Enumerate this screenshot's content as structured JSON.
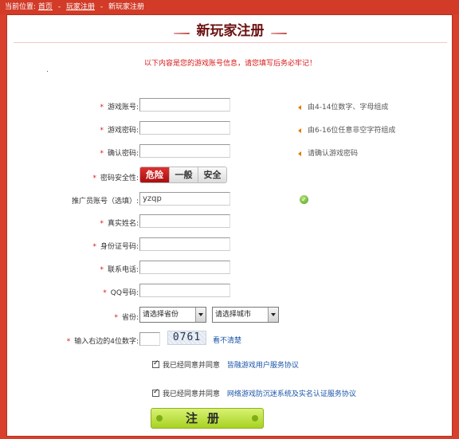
{
  "breadcrumb": {
    "prefix": "当前位置:",
    "home": "首页",
    "sep1": "-",
    "register": "玩家注册",
    "sep2": "-",
    "current": "新玩家注册"
  },
  "page": {
    "title": "新玩家注册",
    "notice": "以下内容是您的游戏账号信息，请您填写后务必牢记！"
  },
  "fields": {
    "account": {
      "required": "*",
      "label": "游戏账号:",
      "value": "",
      "hint": "由4-14位数字、字母组成"
    },
    "password": {
      "required": "*",
      "label": "游戏密码:",
      "value": "",
      "hint": "由6-16位任意非空字符组成"
    },
    "confirm": {
      "required": "*",
      "label": "确认密码:",
      "value": "",
      "hint": "请确认游戏密码"
    },
    "strength": {
      "required": "*",
      "label": "密码安全性:",
      "levels": [
        "危险",
        "一般",
        "安全"
      ],
      "active": "危险"
    },
    "promoter": {
      "label": "推广员账号（选填）:",
      "value": "yzqp",
      "status": "valid"
    },
    "realname": {
      "required": "*",
      "label": "真实姓名:",
      "value": ""
    },
    "idcard": {
      "required": "*",
      "label": "身份证号码:",
      "value": ""
    },
    "phone": {
      "required": "*",
      "label": "联系电话:",
      "value": ""
    },
    "qq": {
      "required": "*",
      "label": "QQ号码:",
      "value": ""
    },
    "region": {
      "required": "*",
      "label": "省份:",
      "province": "请选择省份",
      "city": "请选择城市"
    },
    "captcha": {
      "required": "*",
      "label": "输入右边的4位数字:",
      "value": "",
      "code": "0761",
      "refresh": "看不清楚"
    }
  },
  "agreements": {
    "user": {
      "text": "我已经同意并同意",
      "link": "皆融游戏用户服务协议",
      "checked": true
    },
    "antiaddiction": {
      "text": "我已经同意并同意",
      "link": "网络游戏防沉迷系统及实名认证服务协议",
      "checked": true
    }
  },
  "submit": {
    "label": "注册"
  },
  "colors": {
    "frame": "#d8402c",
    "notice": "#d81818",
    "title": "#6b1010",
    "submit": "#b6dc35",
    "link": "#1a55a8"
  }
}
